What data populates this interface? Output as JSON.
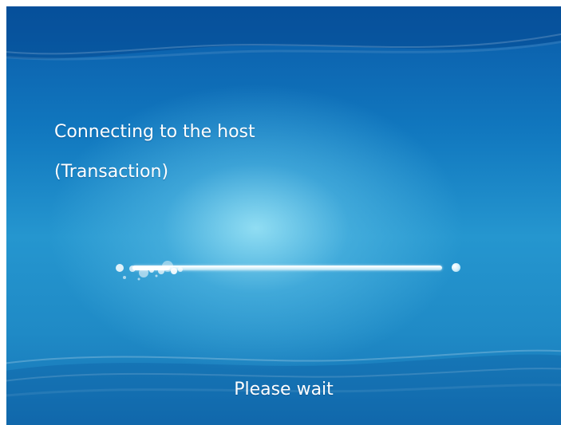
{
  "screen": {
    "message_line1": "Connecting to the host",
    "message_line2": "(Transaction)",
    "status_text": "Please wait"
  },
  "progress": {
    "state": "indeterminate",
    "fraction_shown": 0.12
  },
  "colors": {
    "background_top": "#0a5aa8",
    "background_center": "#96e1f5",
    "background_bottom": "#1672b4",
    "text": "#ffffff",
    "progress_track": "#dff4fc"
  },
  "icons": {
    "progress_indicator": "bubble-progress-icon"
  }
}
